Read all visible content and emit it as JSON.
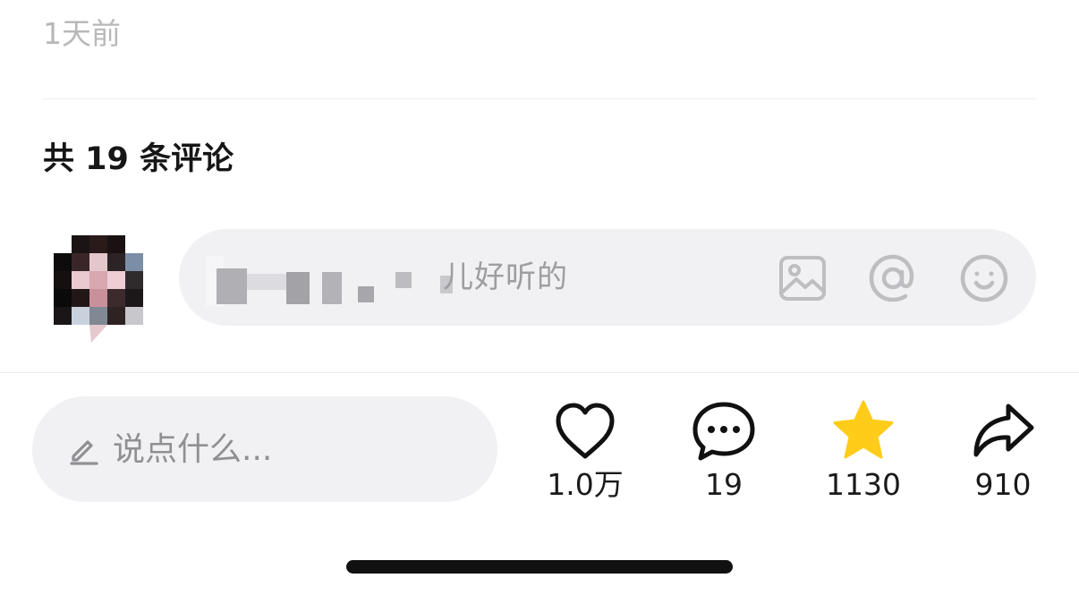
{
  "post": {
    "timestamp": "1天前"
  },
  "comments": {
    "count_label": "共 19 条评论",
    "composer": {
      "hint_visible": "儿好听的",
      "icons": [
        "image-icon",
        "at-icon",
        "emoji-icon"
      ]
    }
  },
  "bottom_bar": {
    "placeholder": "说点什么...",
    "actions": [
      {
        "name": "like",
        "icon": "heart-icon",
        "count": "1.0万"
      },
      {
        "name": "comment",
        "icon": "comment-bubble-icon",
        "count": "19"
      },
      {
        "name": "collect",
        "icon": "star-icon",
        "count": "1130",
        "color": "#FFCC1A"
      },
      {
        "name": "share",
        "icon": "share-arrow-icon",
        "count": "910"
      }
    ]
  },
  "colors": {
    "muted_text": "#B8B8B8",
    "input_bg": "#F1F1F3",
    "star": "#FFCC1A"
  }
}
